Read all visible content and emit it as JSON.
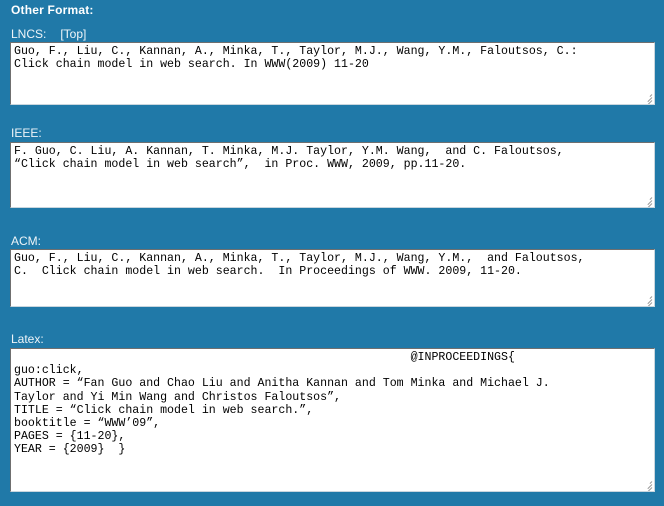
{
  "page": {
    "background_color": "#2079a8",
    "heading": "Other Format:"
  },
  "sections": [
    {
      "id": "lncs",
      "label": "LNCS:",
      "top_link": "[Top]",
      "textarea_value": "Guo, F., Liu, C., Kannan, A., Minka, T., Taylor, M.J., Wang, Y.M., Faloutsos, C.:\nClick chain model in web search. In WWW(2009) 11-20"
    },
    {
      "id": "ieee",
      "label": "IEEE:",
      "top_link": "",
      "textarea_value": "F. Guo, C. Liu, A. Kannan, T. Minka, M.J. Taylor, Y.M. Wang,  and C. Faloutsos,\n“Click chain model in web search”,  in Proc. WWW, 2009, pp.11-20."
    },
    {
      "id": "acm",
      "label": "ACM:",
      "top_link": "",
      "textarea_value": "Guo, F., Liu, C., Kannan, A., Minka, T., Taylor, M.J., Wang, Y.M.,  and Faloutsos,\nC.  Click chain model in web search.  In Proceedings of WWW. 2009, 11-20."
    },
    {
      "id": "latex",
      "label": "Latex:",
      "top_link": "",
      "textarea_value": "                                                         @INPROCEEDINGS{\nguo:click,\nAUTHOR = “Fan Guo and Chao Liu and Anitha Kannan and Tom Minka and Michael J.\nTaylor and Yi Min Wang and Christos Faloutsos”,\nTITLE = “Click chain model in web search.”,\nbooktitle = “WWW’09”,\nPAGES = {11-20},\nYEAR = {2009}  }"
    }
  ],
  "icons": {
    "resize_grip": "resize-grip-icon"
  }
}
